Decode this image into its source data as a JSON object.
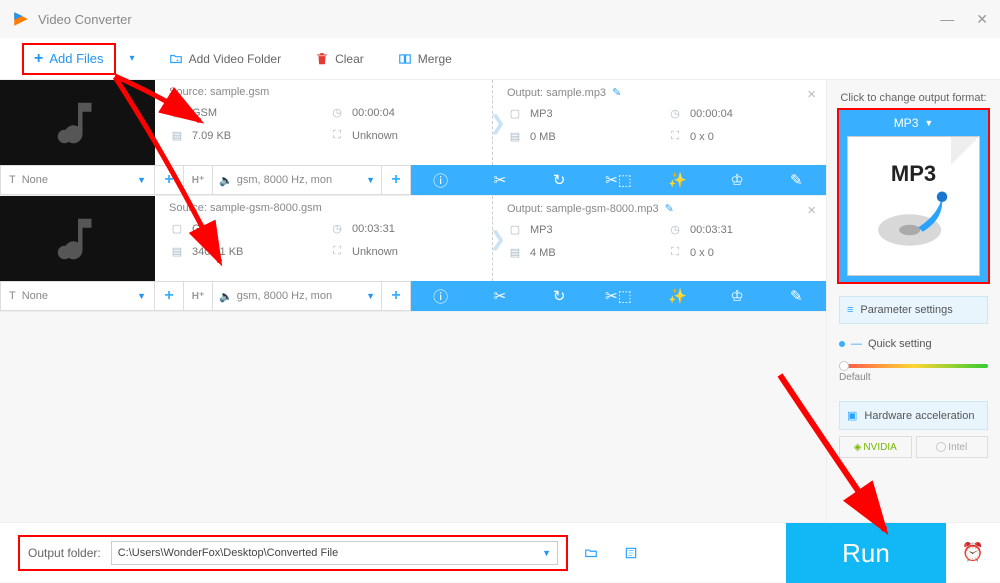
{
  "app": {
    "title": "Video Converter"
  },
  "toolbar": {
    "add_files": "Add Files",
    "add_folder": "Add Video Folder",
    "clear": "Clear",
    "merge": "Merge"
  },
  "files": [
    {
      "source_label": "Source: sample.gsm",
      "src_format": "GSM",
      "src_duration": "00:00:04",
      "src_size": "7.09 KB",
      "src_res": "Unknown",
      "output_label": "Output: sample.mp3",
      "out_format": "MP3",
      "out_duration": "00:00:04",
      "out_size": "0 MB",
      "out_res": "0 x 0",
      "subtitle": "None",
      "audio_opt": "gsm, 8000 Hz, mon"
    },
    {
      "source_label": "Source: sample-gsm-8000.gsm",
      "src_format": "GSM",
      "src_duration": "00:03:31",
      "src_size": "340.41 KB",
      "src_res": "Unknown",
      "output_label": "Output: sample-gsm-8000.mp3",
      "out_format": "MP3",
      "out_duration": "00:03:31",
      "out_size": "4 MB",
      "out_res": "0 x 0",
      "subtitle": "None",
      "audio_opt": "gsm, 8000 Hz, mon"
    }
  ],
  "right": {
    "hint": "Click to change output format:",
    "format": "MP3",
    "param_settings": "Parameter settings",
    "quick_setting": "Quick setting",
    "slider_default": "Default",
    "hardware_accel": "Hardware acceleration",
    "nvidia": "NVIDIA",
    "intel": "Intel"
  },
  "bottom": {
    "label": "Output folder:",
    "path": "C:\\Users\\WonderFox\\Desktop\\Converted File",
    "run": "Run"
  }
}
